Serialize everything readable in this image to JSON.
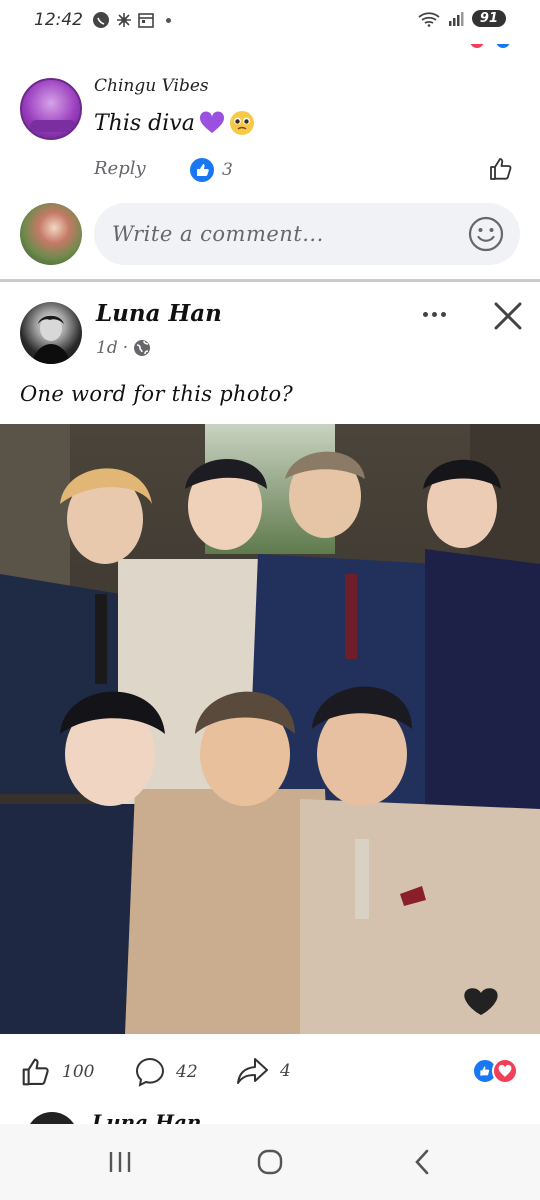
{
  "status_bar": {
    "time": "12:42",
    "battery": "91"
  },
  "comment": {
    "author": "Chingu Vibes",
    "text": "This diva",
    "emojis": [
      "purple-heart",
      "pleading-face"
    ],
    "reply_label": "Reply",
    "like_count": "3"
  },
  "composer": {
    "placeholder": "Write a comment..."
  },
  "post": {
    "author": "Luna Han",
    "time_ago": "1d",
    "caption": "One word for this photo?",
    "likes": "100",
    "comments": "42",
    "shares": "4",
    "reactions": [
      "like",
      "love"
    ]
  },
  "next_post": {
    "author": "Luna Han"
  },
  "colors": {
    "facebook_blue": "#1877f2",
    "love_red": "#f33e58",
    "input_bg": "#f0f2f5",
    "secondary_text": "#65676b"
  }
}
